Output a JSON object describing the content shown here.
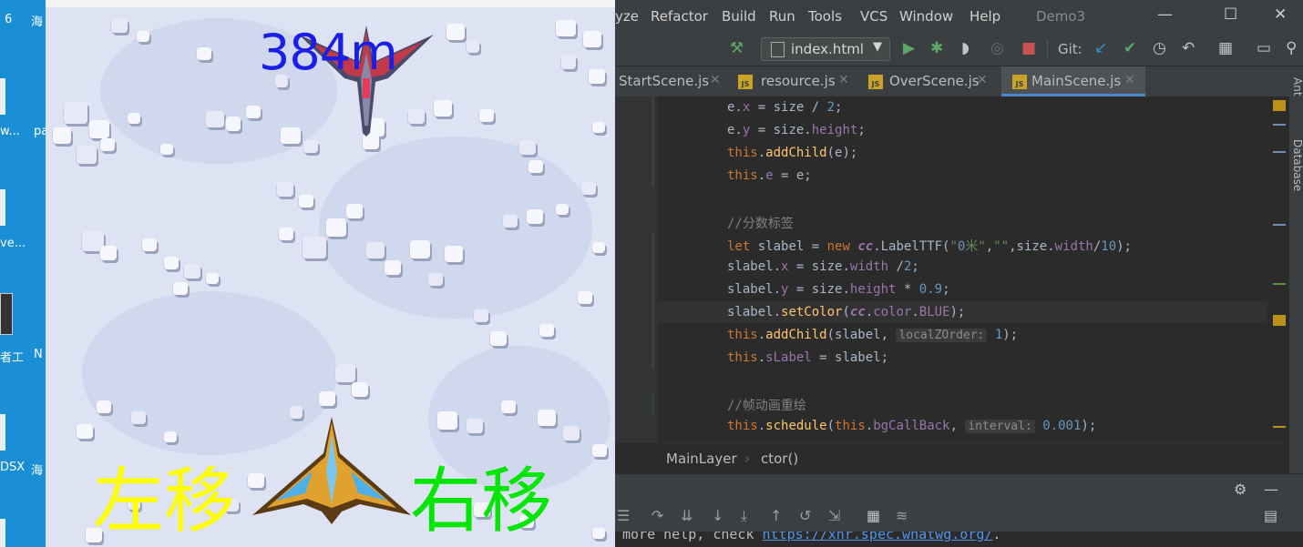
{
  "desktop": {
    "labels": [
      "6",
      "海",
      "w...",
      "pa",
      "ve...",
      "者工",
      "N",
      "DSX",
      "海"
    ]
  },
  "game": {
    "distance": "384m",
    "left_label": "左移",
    "right_label": "右移",
    "colors": {
      "distance": "#1a1ee6",
      "left": "#ffff00",
      "right": "#00e600"
    }
  },
  "ide": {
    "menu": [
      "yze",
      "Refactor",
      "Build",
      "Run",
      "Tools",
      "VCS",
      "Window",
      "Help"
    ],
    "project_title": "Demo3",
    "run_config": "index.html",
    "git_label": "Git:",
    "tabs": [
      {
        "label": "StartScene.js",
        "active": false
      },
      {
        "label": "resource.js",
        "active": false
      },
      {
        "label": "OverScene.js",
        "active": false
      },
      {
        "label": "MainScene.js",
        "active": true
      }
    ],
    "right_tools": [
      "Ant",
      "Database"
    ],
    "code": [
      "e.x = size / 2;",
      "e.y = size.height;",
      "this.addChild(e);",
      "this.e = e;",
      "",
      "//分数标签",
      "let slabel = new cc.LabelTTF(\"0米\",\"\",size.width/10);",
      "slabel.x = size.width /2;",
      "slabel.y = size.height * 0.9;",
      "slabel.setColor(cc.color.BLUE);",
      "this.addChild(slabel, localZOrder: 1);",
      "this.sLabel = slabel;",
      "",
      "//帧动画重绘",
      "this.schedule(this.bgCallBack, interval: 0.001);"
    ],
    "hints": {
      "localZOrder": "localZOrder:",
      "interval": "interval:"
    },
    "breadcrumb": [
      "MainLayer",
      "ctor()"
    ],
    "console_prefix": "more help, check ",
    "console_link": "https://xhr.spec.whatwg.org/",
    "console_suffix": "."
  }
}
